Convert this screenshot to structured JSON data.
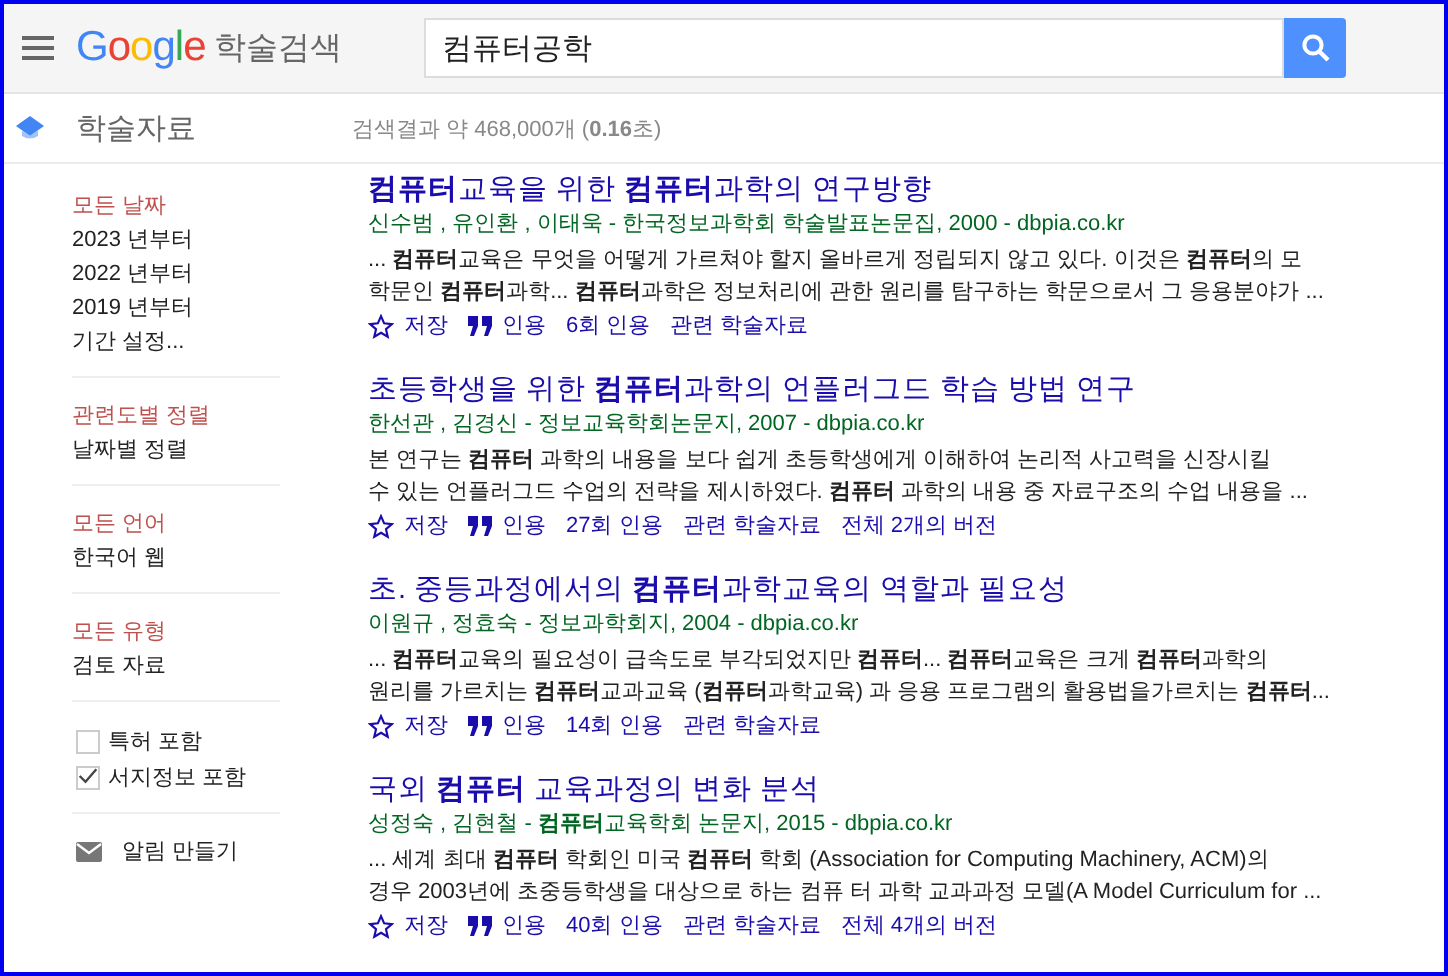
{
  "header": {
    "logo": "Google",
    "logo_suffix": "학술검색",
    "search_value": "컴퓨터공학"
  },
  "subheader": {
    "section": "학술자료",
    "result_stats": "검색결과 약 468,000개 (**0.16**초)"
  },
  "sidebar": {
    "sections": [
      {
        "kind": "links",
        "items": [
          {
            "label": "모든 날짜",
            "selected": true
          },
          {
            "label": "2023 년부터",
            "selected": false
          },
          {
            "label": "2022 년부터",
            "selected": false
          },
          {
            "label": "2019 년부터",
            "selected": false
          },
          {
            "label": "기간 설정...",
            "selected": false
          }
        ]
      },
      {
        "kind": "links",
        "items": [
          {
            "label": "관련도별 정렬",
            "selected": true
          },
          {
            "label": "날짜별 정렬",
            "selected": false
          }
        ]
      },
      {
        "kind": "links",
        "items": [
          {
            "label": "모든 언어",
            "selected": true
          },
          {
            "label": "한국어 웹",
            "selected": false
          }
        ]
      },
      {
        "kind": "links",
        "items": [
          {
            "label": "모든 유형",
            "selected": true
          },
          {
            "label": "검토 자료",
            "selected": false
          }
        ]
      },
      {
        "kind": "checkboxes",
        "items": [
          {
            "label": "특허 포함",
            "checked": false
          },
          {
            "label": "서지정보 포함",
            "checked": true
          }
        ]
      },
      {
        "kind": "alert",
        "items": [
          {
            "label": "알림 만들기"
          }
        ]
      }
    ]
  },
  "results": [
    {
      "title": "**컴퓨터**교육을 위한 **컴퓨터**과학의 연구방향",
      "source": "신수범 ,  유인환 ,  이태욱 - 한국정보과학회 학술발표논문집, 2000 - dbpia.co.kr",
      "snippet": [
        "... **컴퓨터**교육은 무엇을 어떻게 가르쳐야 할지 올바르게 정립되지 않고 있다. 이것은 **컴퓨터**의 모",
        "학문인 **컴퓨터**과학... **컴퓨터**과학은 정보처리에 관한 원리를 탐구하는 학문으로서 그 응용분야가 ..."
      ],
      "actions": [
        "저장",
        "인용",
        "6회 인용",
        "관련 학술자료"
      ]
    },
    {
      "title": "초등학생을 위한 **컴퓨터**과학의 언플러그드 학습 방법 연구",
      "source": "한선관 ,  김경신 - 정보교육학회논문지, 2007 - dbpia.co.kr",
      "snippet": [
        "본 연구는 **컴퓨터** 과학의 내용을 보다 쉽게 초등학생에게 이해하여 논리적 사고력을 신장시킬",
        "수 있는 언플러그드 수업의 전략을 제시하였다. **컴퓨터** 과학의 내용 중 자료구조의 수업 내용을 ..."
      ],
      "actions": [
        "저장",
        "인용",
        "27회 인용",
        "관련 학술자료",
        "전체 2개의 버전"
      ]
    },
    {
      "title": "초. 중등과정에서의 **컴퓨터**과학교육의 역할과 필요성",
      "source": "이원규 ,  정효숙 - 정보과학회지, 2004 - dbpia.co.kr",
      "snippet": [
        "... **컴퓨터**교육의 필요성이 급속도로 부각되었지만 **컴퓨터**... **컴퓨터**교육은 크게 **컴퓨터**과학의",
        "원리를 가르치는 **컴퓨터**교과교육 (**컴퓨터**과학교육) 과 응용 프로그램의 활용법을가르치는 **컴퓨터**..."
      ],
      "actions": [
        "저장",
        "인용",
        "14회 인용",
        "관련 학술자료"
      ]
    },
    {
      "title": "국외 **컴퓨터** 교육과정의 변화 분석",
      "source": "성정숙 ,  김현철 - **컴퓨터**교육학회 논문지, 2015 - dbpia.co.kr",
      "snippet": [
        "... 세계 최대 **컴퓨터** 학회인 미국 **컴퓨터** 학회 (Association for Computing Machinery, ACM)의",
        "경우 2003년에 초중등학생을 대상으로 하는 컴퓨 터 과학 교과과정 모델(A Model Curriculum for ..."
      ],
      "actions": [
        "저장",
        "인용",
        "40회 인용",
        "관련 학술자료",
        "전체 4개의 버전"
      ]
    }
  ]
}
